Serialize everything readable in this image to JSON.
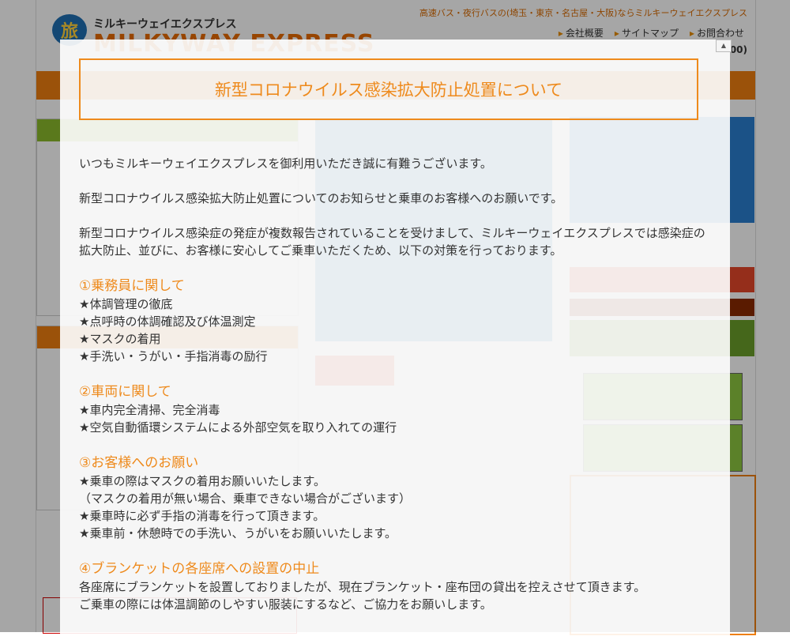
{
  "header": {
    "logo_mark": "旅",
    "logo_jp": "ミルキーウェイエクスプレス",
    "logo_en": "MILKYWAY EXPRESS",
    "tagline": "高速バス・夜行バスの(埼玉・東京・名古屋・大阪)ならミルキーウェイエクスプレス",
    "links": [
      "会社概要",
      "サイトマップ",
      "お問合わせ"
    ],
    "phone_suffix": "00)"
  },
  "modal": {
    "close_label": "▲",
    "title": "新型コロナウイルス感染拡大防止処置について",
    "intro": [
      "いつもミルキーウェイエクスプレスを御利用いただき誠に有難うございます。",
      "新型コロナウイルス感染拡大防止処置についてのお知らせと乗車のお客様へのお願いです。",
      "新型コロナウイルス感染症の発症が複数報告されていることを受けまして、ミルキーウェイエクスプレスでは感染症の拡大防止、並びに、お客様に安心してご乗車いただくため、以下の対策を行っております。"
    ],
    "sections": [
      {
        "heading": "①乗務員に関して",
        "items": [
          "★体調管理の徹底",
          "★点呼時の体調確認及び体温測定",
          "★マスクの着用",
          "★手洗い・うがい・手指消毒の励行"
        ]
      },
      {
        "heading": "②車両に関して",
        "items": [
          "★車内完全清掃、完全消毒",
          "★空気自動循環システムによる外部空気を取り入れての運行"
        ]
      },
      {
        "heading": "③お客様へのお願い",
        "items": [
          "★乗車の際はマスクの着用お願いいたします。",
          "（マスクの着用が無い場合、乗車できない場合がございます）",
          "★乗車時に必ず手指の消毒を行って頂きます。",
          "★乗車前・休憩時での手洗い、うがいをお願いいたします。"
        ]
      },
      {
        "heading": "④ブランケットの各座席への設置の中止",
        "items": [
          "各座席にブランケットを設置しておりましたが、現在ブランケット・座布団の貸出を控えさせて頂きます。",
          "ご乗車の際には体温調節のしやすい服装にするなど、ご協力をお願いします。"
        ]
      }
    ]
  }
}
